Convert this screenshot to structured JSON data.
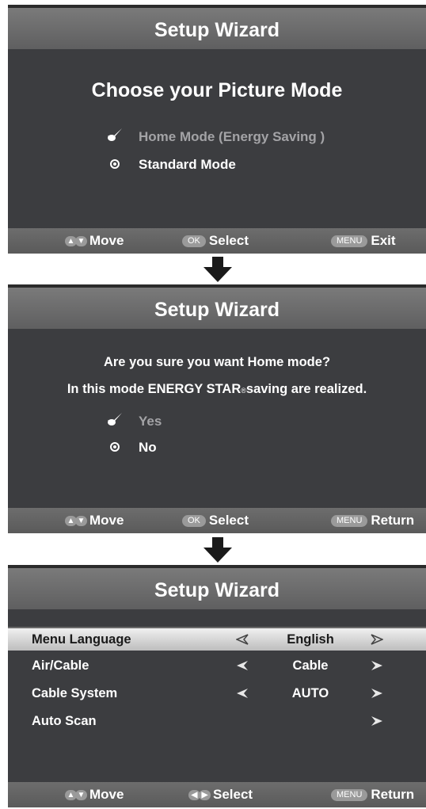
{
  "screen1": {
    "title": "Setup Wizard",
    "heading": "Choose your Picture Mode",
    "options": [
      {
        "label": "Home Mode (Energy Saving  )",
        "state": "selected"
      },
      {
        "label": "Standard Mode",
        "state": "normal"
      }
    ],
    "footer": {
      "move": "Move",
      "ok_key": "OK",
      "select": "Select",
      "menu_key": "MENU",
      "exit": "Exit"
    }
  },
  "screen2": {
    "title": "Setup Wizard",
    "question_line1": "Are you sure you want Home mode?",
    "question_line2": "In this mode ENERGY STAR",
    "question_line2_end": "saving are realized.",
    "registered_mark": "®",
    "options": [
      {
        "label": "Yes",
        "state": "selected"
      },
      {
        "label": "No",
        "state": "normal"
      }
    ],
    "footer": {
      "move": "Move",
      "ok_key": "OK",
      "select": "Select",
      "menu_key": "MENU",
      "return": "Return"
    }
  },
  "screen3": {
    "title": "Setup Wizard",
    "rows": [
      {
        "label": "Menu Language",
        "value": "English",
        "highlighted": true
      },
      {
        "label": "Air/Cable",
        "value": "Cable",
        "highlighted": false
      },
      {
        "label": "Cable System",
        "value": "AUTO",
        "highlighted": false
      },
      {
        "label": "Auto Scan",
        "value": "",
        "highlighted": false
      }
    ],
    "footer": {
      "move": "Move",
      "select": "Select",
      "menu_key": "MENU",
      "return": "Return"
    }
  },
  "colors": {
    "panel_bg": "#3c3d40",
    "selected_text": "#a3a3a6",
    "highlight_row": "#dcdcdc"
  },
  "icons": [
    "checkmark-icon",
    "radio-icon",
    "down-arrow-icon",
    "left-arrow-icon",
    "right-arrow-icon",
    "up-down-key-icon",
    "left-right-key-icon"
  ]
}
